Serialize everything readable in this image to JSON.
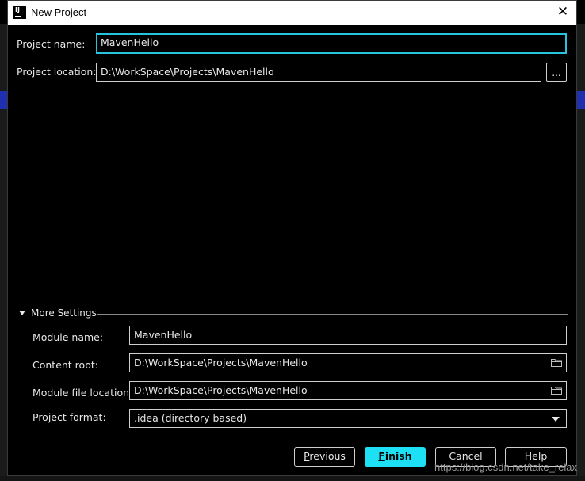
{
  "window": {
    "title": "New Project",
    "app_icon_text": "IJ",
    "close_glyph": "✕"
  },
  "project": {
    "name_label": "Project name:",
    "name_value": "MavenHello",
    "location_label": "Project location:",
    "location_value": "D:\\WorkSpace\\Projects\\MavenHello",
    "browse_label": "..."
  },
  "more_settings": {
    "title": "More Settings",
    "module_name_label": "Module name:",
    "module_name_value": "MavenHello",
    "content_root_label": "Content root:",
    "content_root_value": "D:\\WorkSpace\\Projects\\MavenHello",
    "module_file_location_label": "Module file location:",
    "module_file_location_value": "D:\\WorkSpace\\Projects\\MavenHello",
    "project_format_label": "Project format:",
    "project_format_value": ".idea (directory based)"
  },
  "buttons": {
    "previous_mnemonic": "P",
    "previous_rest": "revious",
    "finish_mnemonic": "F",
    "finish_rest": "inish",
    "cancel": "Cancel",
    "help": "Help"
  },
  "watermark": "https://blog.csdn.net/take_relax",
  "colors": {
    "accent": "#1ee0f5",
    "focus_border": "#27c3dd",
    "background": "#000000"
  }
}
